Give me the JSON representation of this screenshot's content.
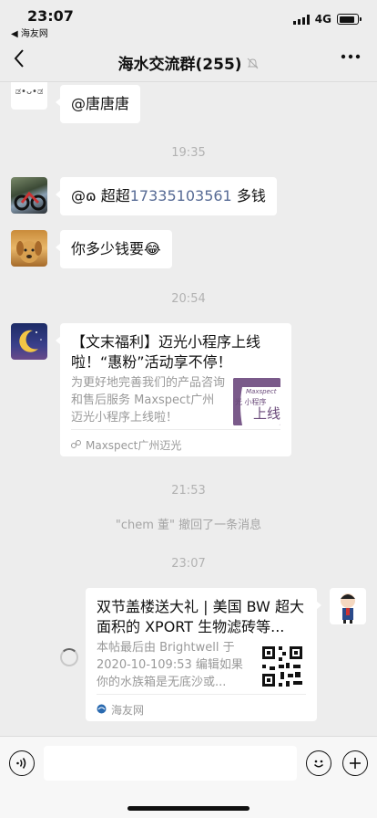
{
  "status_bar": {
    "time": "23:07",
    "back_app": "◀ 海友网",
    "network": "4G",
    "battery_level": 0.85
  },
  "nav": {
    "title": "海水交流群(255)",
    "mute_icon": "bell-off-icon",
    "more_icon": "more-dots-icon"
  },
  "messages": {
    "m1": {
      "avatar_text": "ಡ•ᴗ•ಡ",
      "text": "@唐唐唐"
    },
    "t1": "19:35",
    "m2": {
      "prefix": "@ɷ 超超",
      "phone": "17335103561",
      "suffix": " 多钱"
    },
    "m3": {
      "text": "你多少钱要😂"
    },
    "t2": "20:54",
    "card1": {
      "title": "【文末福利】迈光小程序上线啦！“惠粉”活动享不停！",
      "desc": "为更好地完善我们的产品咨询和售后服务 Maxspect广州迈光小程序上线啦！",
      "thumb_line1": "Maxspect",
      "thumb_line2": "光 小程序",
      "thumb_line3": "上线",
      "source": "Maxspect广州迈光"
    },
    "t3": "21:53",
    "recall": "\"chem 董\" 撤回了一条消息",
    "t4": "23:07",
    "card2": {
      "title": "双节盖楼送大礼 | 美国 BW 超大面积的 XPORT 生物滤砖等...",
      "desc": "本帖最后由 Brightwell 于 2020-10-109:53 编辑如果你的水族箱是无底沙或...",
      "source": "海友网"
    }
  },
  "input_bar": {
    "voice_icon": "voice-icon",
    "emoji_icon": "emoji-icon",
    "plus_icon": "plus-icon"
  }
}
